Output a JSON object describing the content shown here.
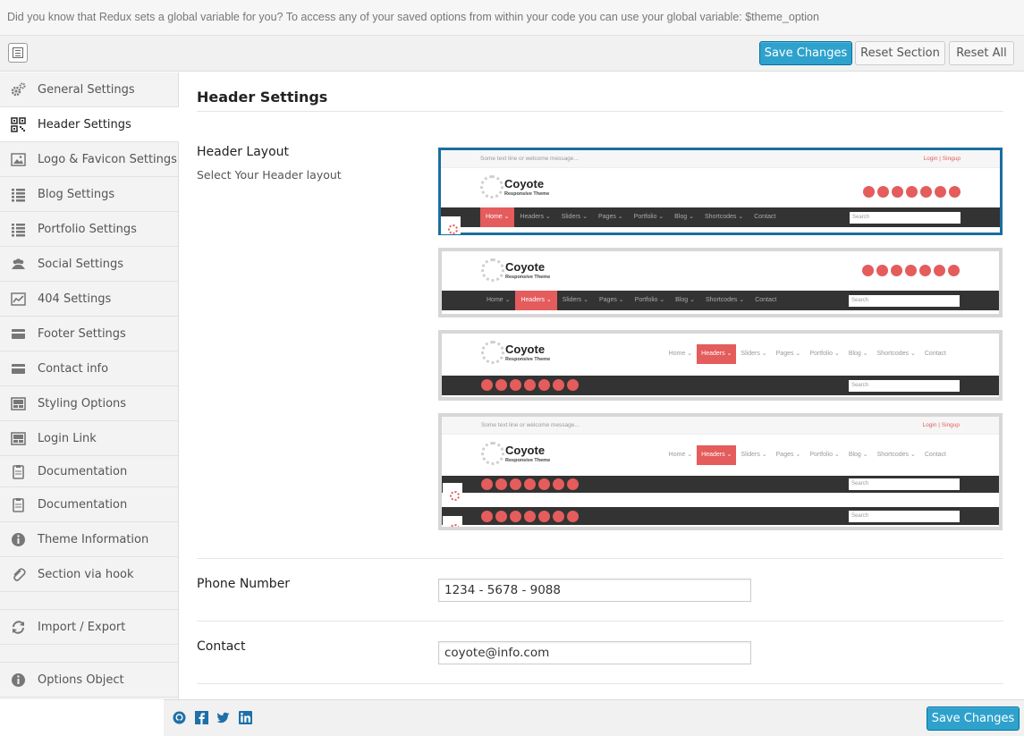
{
  "notice": {
    "text": "Did you know that Redux sets a global variable for you? To access any of your saved options from within your code you can use your global variable: $theme_option"
  },
  "toolbar": {
    "save_label": "Save Changes",
    "reset_section_label": "Reset Section",
    "reset_all_label": "Reset All"
  },
  "sidebar": {
    "items": [
      {
        "label": "General Settings",
        "icon": "gears-icon"
      },
      {
        "label": "Header Settings",
        "icon": "qrcode-icon",
        "active": true
      },
      {
        "label": "Logo & Favicon Settings",
        "icon": "picture-icon"
      },
      {
        "label": "Blog Settings",
        "icon": "list-icon"
      },
      {
        "label": "Portfolio Settings",
        "icon": "list-icon"
      },
      {
        "label": "Social Settings",
        "icon": "group-icon"
      },
      {
        "label": "404 Settings",
        "icon": "chart-icon"
      },
      {
        "label": "Footer Settings",
        "icon": "credit-card-icon"
      },
      {
        "label": "Contact info",
        "icon": "credit-card-icon"
      },
      {
        "label": "Styling Options",
        "icon": "website-icon"
      },
      {
        "label": "Login Link",
        "icon": "website-icon"
      },
      {
        "label": "Documentation",
        "icon": "clipboard-icon"
      },
      {
        "label": "Documentation",
        "icon": "clipboard-icon"
      },
      {
        "label": "Theme Information",
        "icon": "info-icon"
      },
      {
        "label": "Section via hook",
        "icon": "paperclip-icon"
      },
      {
        "label": "Import / Export",
        "icon": "refresh-icon"
      },
      {
        "label": "Options Object",
        "icon": "info-icon"
      }
    ]
  },
  "main": {
    "section_title": "Header Settings",
    "header_layout": {
      "title": "Header Layout",
      "subtitle": "Select Your Header layout",
      "selected_index": 0,
      "preview": {
        "top_left": "Some text line or welcome message...",
        "top_right": "Login | Singup",
        "brand": "Coyote",
        "tagline": "Responsive Theme",
        "nav": [
          "Home ⌄",
          "Headers ⌄",
          "Sliders ⌄",
          "Pages ⌄",
          "Portfolio ⌄",
          "Blog ⌄",
          "Shortcodes ⌄",
          "Contact"
        ],
        "search": "Search"
      }
    },
    "phone": {
      "title": "Phone Number",
      "value": "1234 - 5678 - 9088"
    },
    "contact": {
      "title": "Contact",
      "value": "coyote@info.com"
    }
  },
  "footer": {
    "save_label": "Save Changes",
    "social_icons": [
      "github-icon",
      "facebook-icon",
      "twitter-icon",
      "linkedin-icon"
    ]
  },
  "colors": {
    "accent": "#2ea2cc",
    "selected_border": "#1a6e9e",
    "preview_red": "#e45c5c"
  }
}
